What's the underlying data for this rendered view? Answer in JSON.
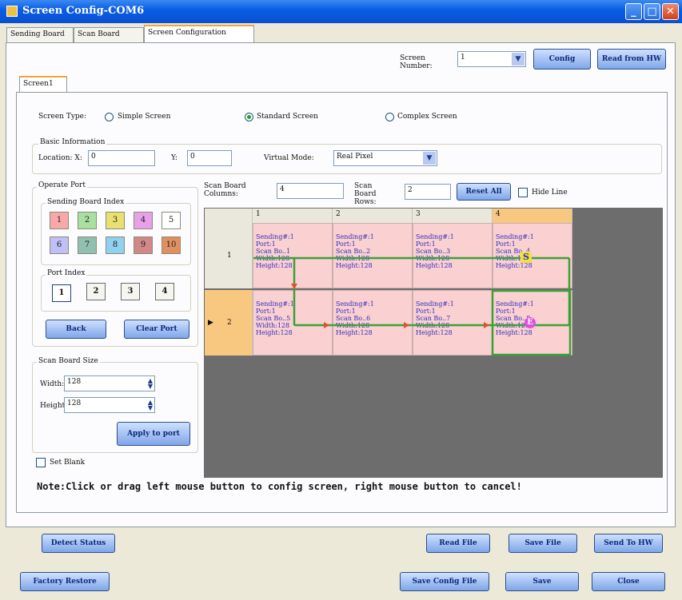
{
  "window": {
    "title": "Screen Config-COM6",
    "minimize": "_",
    "maximize": "□",
    "close": "✕"
  },
  "tabs": [
    {
      "label": "Sending Board"
    },
    {
      "label": "Scan Board"
    },
    {
      "label": "Screen Configuration"
    }
  ],
  "screen_number": {
    "label": "Screen Number:",
    "value": "1",
    "config_label": "Config",
    "read_label": "Read from HW"
  },
  "screen_tab": "Screen1",
  "screen_type": {
    "label": "Screen Type:",
    "options": [
      {
        "label": "Simple Screen",
        "selected": false
      },
      {
        "label": "Standard Screen",
        "selected": true
      },
      {
        "label": "Complex Screen",
        "selected": false
      }
    ]
  },
  "basic_info": {
    "title": "Basic Information",
    "location_x_label": "Location: X:",
    "x": "0",
    "y_label": "Y:",
    "y": "0",
    "virtual_mode_label": "Virtual Mode:",
    "virtual_mode": "Real Pixel"
  },
  "operate_port": {
    "title": "Operate Port",
    "sending_board_index_title": "Sending Board Index",
    "sending_boards": [
      {
        "n": "1",
        "color": "#f8a8a8"
      },
      {
        "n": "2",
        "color": "#a8e0a0"
      },
      {
        "n": "3",
        "color": "#e8e070"
      },
      {
        "n": "4",
        "color": "#e8a0e8"
      },
      {
        "n": "5",
        "color": "#ffffff"
      },
      {
        "n": "6",
        "color": "#c0c0f8"
      },
      {
        "n": "7",
        "color": "#90c0b0"
      },
      {
        "n": "8",
        "color": "#90d0f0"
      },
      {
        "n": "9",
        "color": "#d08888"
      },
      {
        "n": "10",
        "color": "#e09060"
      }
    ],
    "port_index_title": "Port Index",
    "ports": [
      "1",
      "2",
      "3",
      "4"
    ],
    "back_label": "Back",
    "clear_port_label": "Clear Port"
  },
  "scan_board_size": {
    "title": "Scan Board Size",
    "width_label": "Width:",
    "width": "128",
    "height_label": "Height",
    "height": "128",
    "apply_label": "Apply to port"
  },
  "set_blank": "Set Blank",
  "scan_board_columns": {
    "label": "Scan Board Columns:",
    "value": "4"
  },
  "scan_board_rows": {
    "label": "Scan Board Rows:",
    "value": "2"
  },
  "reset_all": "Reset All",
  "hide_line": "Hide Line",
  "grid": {
    "columns": [
      "1",
      "2",
      "3",
      "4"
    ],
    "rows": [
      {
        "label": "1",
        "cells": [
          {
            "sending": "Sending#:1",
            "port": "Port:1",
            "scan": "Scan Bo..1",
            "width": "Width:128",
            "height": "Height:128"
          },
          {
            "sending": "Sending#:1",
            "port": "Port:1",
            "scan": "Scan Bo..2",
            "width": "Width:128",
            "height": "Height:128"
          },
          {
            "sending": "Sending#:1",
            "port": "Port:1",
            "scan": "Scan Bo..3",
            "width": "Width:128",
            "height": "Height:128"
          },
          {
            "sending": "Sending#:1",
            "port": "Port:1",
            "scan": "Scan Bo..4",
            "width": "Width:128",
            "height": "Height:128"
          }
        ]
      },
      {
        "label": "2",
        "cells": [
          {
            "sending": "Sending#:1",
            "port": "Port:1",
            "scan": "Scan Bo..5",
            "width": "Width:128",
            "height": "Height:128"
          },
          {
            "sending": "Sending#:1",
            "port": "Port:1",
            "scan": "Scan Bo..6",
            "width": "Width:128",
            "height": "Height:128"
          },
          {
            "sending": "Sending#:1",
            "port": "Port:1",
            "scan": "Scan Bo..7",
            "width": "Width:128",
            "height": "Height:128"
          },
          {
            "sending": "Sending#:1",
            "port": "Port:1",
            "scan": "Scan Bo..8",
            "width": "Width:128",
            "height": "Height:128"
          }
        ]
      }
    ],
    "start_marker": "S",
    "end_marker": "E",
    "row_pointer": "▶"
  },
  "note": "Note:Click or drag left mouse button to config screen, right mouse button to cancel!",
  "bottom": {
    "detect_status": "Detect Status",
    "read_file": "Read File",
    "save_file": "Save File",
    "send_to_hw": "Send To HW",
    "factory_restore": "Factory Restore",
    "save_config_file": "Save Config File",
    "save": "Save",
    "close": "Close"
  },
  "colors": {
    "path": "#3aa13a",
    "cell": "#fbd0d0",
    "accent_header": "#f8c880"
  }
}
